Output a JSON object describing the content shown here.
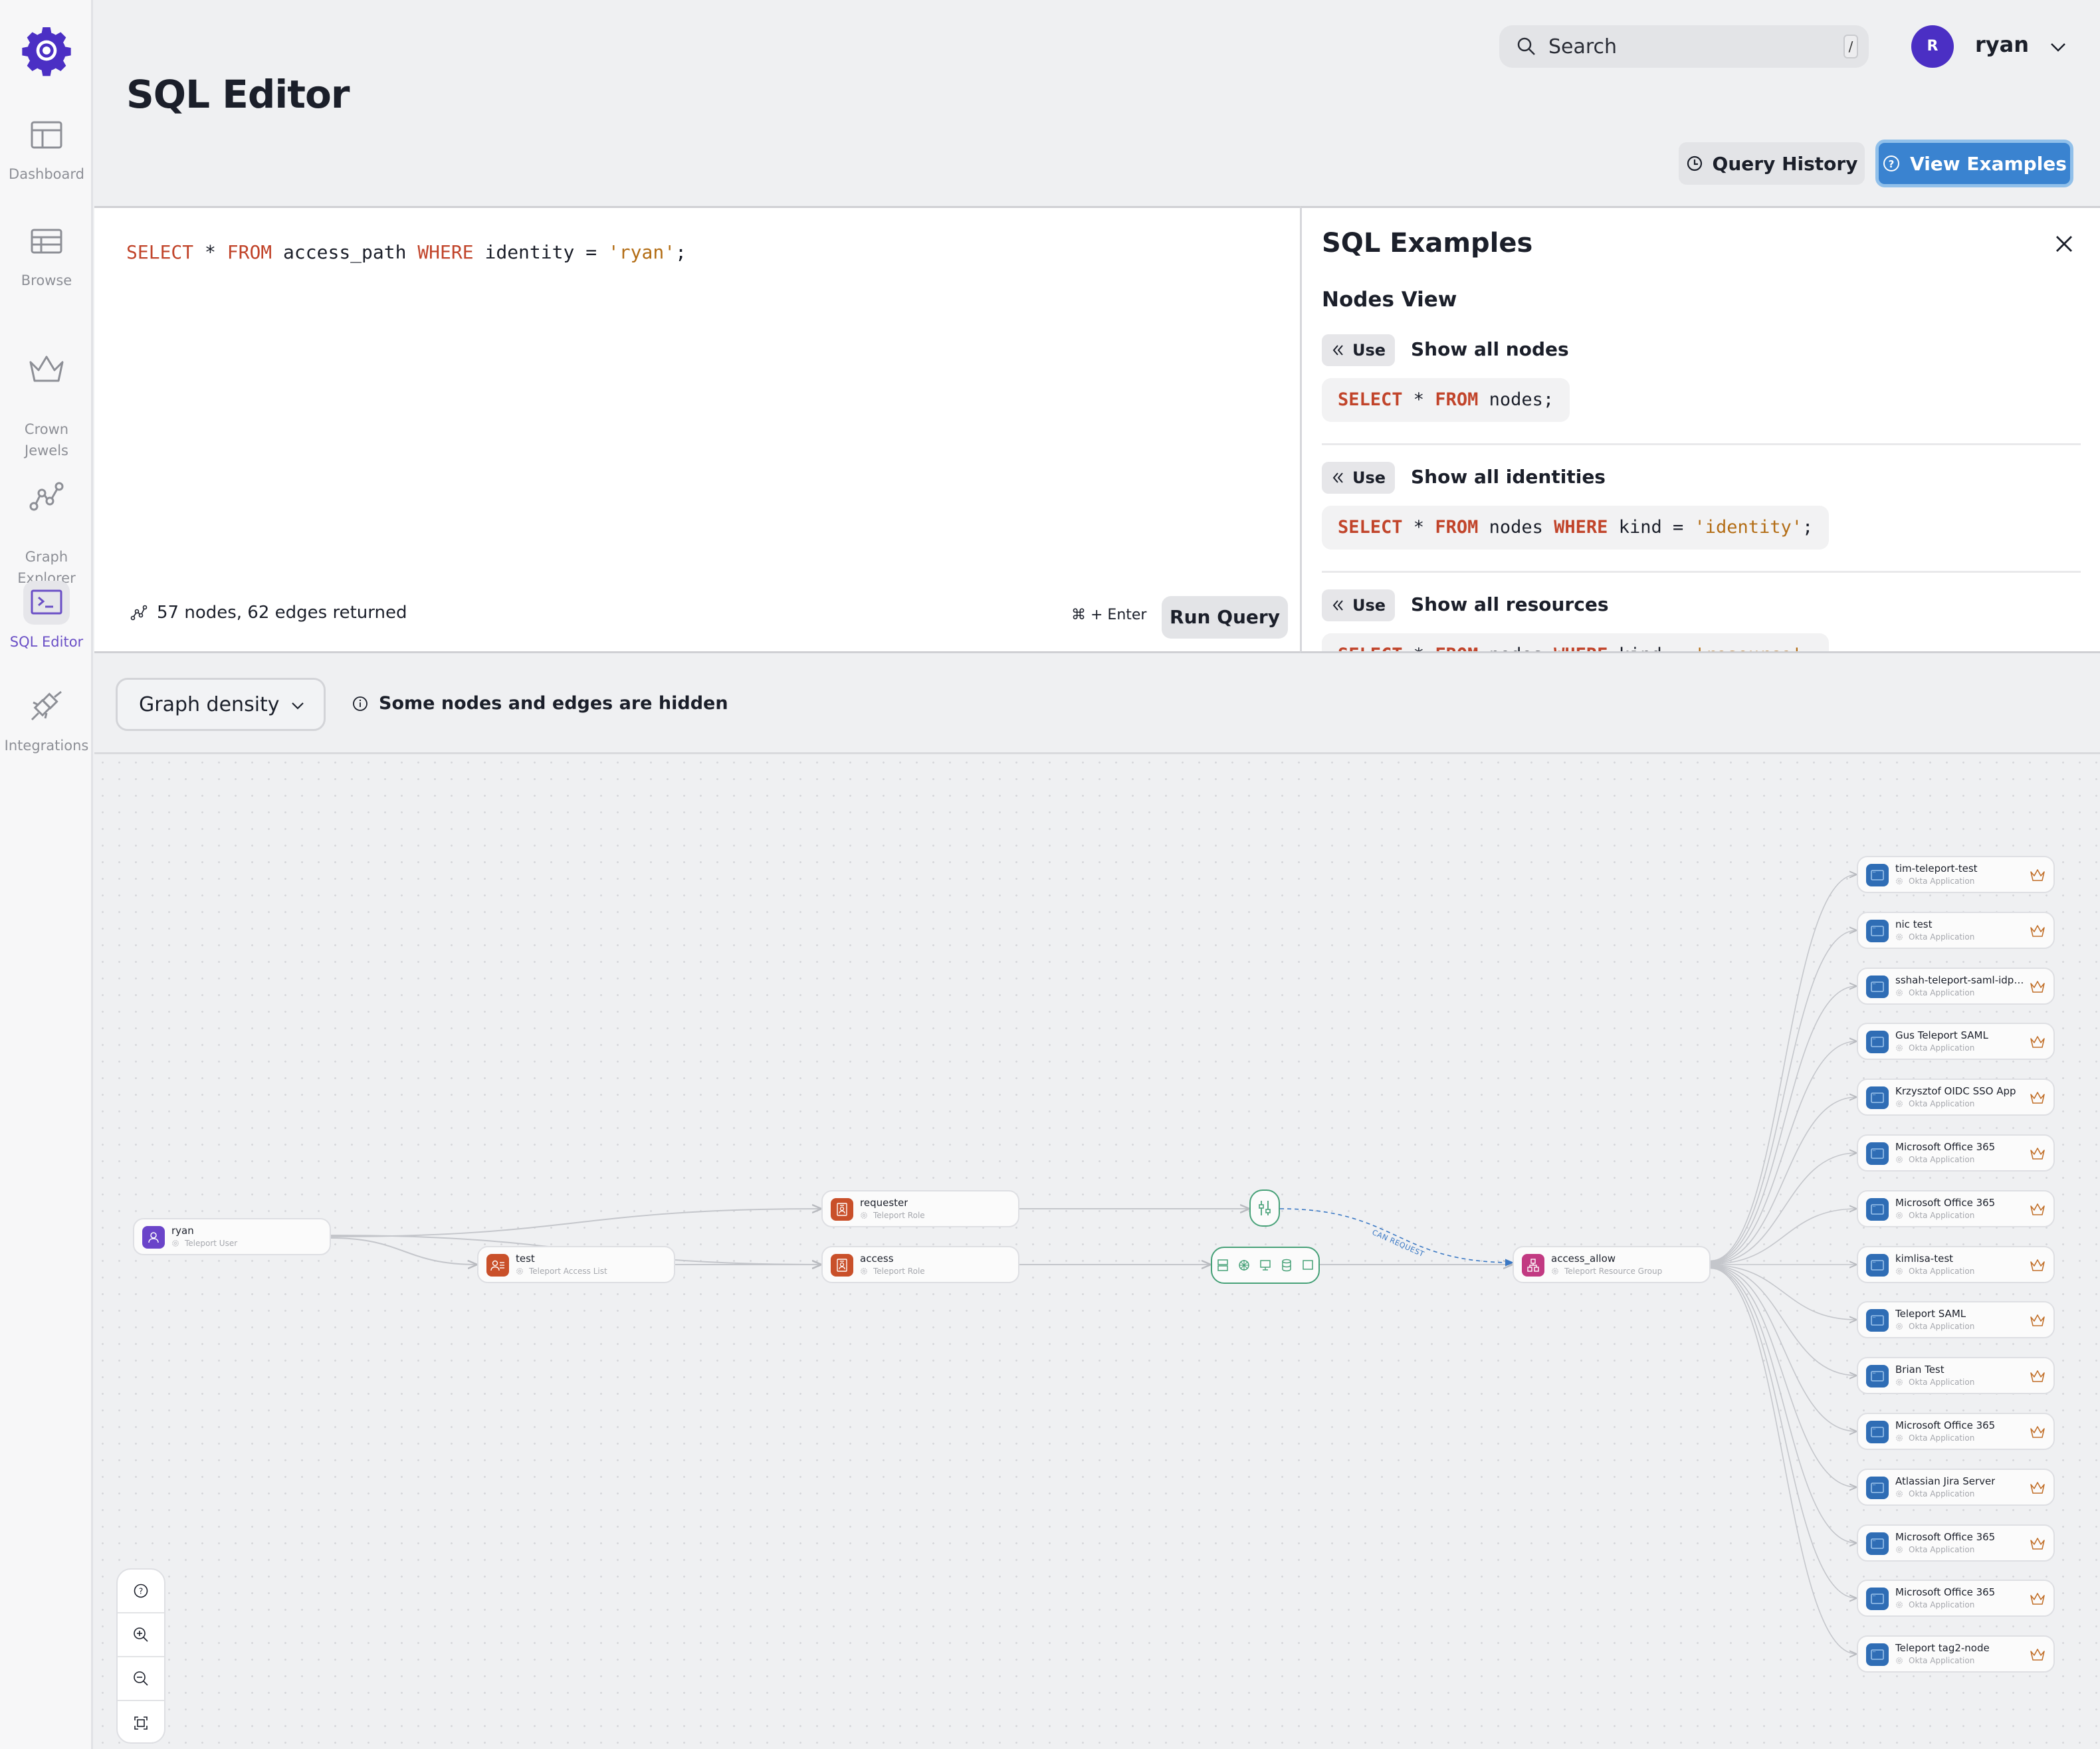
{
  "sidebar": {
    "logo": "gear-logo-icon",
    "items": [
      {
        "label": "Dashboard",
        "icon": "dashboard-icon",
        "active": false
      },
      {
        "label": "Browse",
        "icon": "table-icon",
        "active": false
      },
      {
        "label": "Crown\nJewels",
        "icon": "crown-icon",
        "active": false
      },
      {
        "label": "Graph\nExplorer",
        "icon": "graph-icon",
        "active": false
      },
      {
        "label": "SQL Editor",
        "icon": "terminal-icon",
        "active": true
      },
      {
        "label": "Integrations",
        "icon": "plug-icon",
        "active": false
      }
    ]
  },
  "header": {
    "title": "SQL Editor",
    "search": {
      "placeholder": "Search",
      "shortcut": "/"
    },
    "user": {
      "initial": "R",
      "name": "ryan"
    },
    "query_history_label": "Query History",
    "view_examples_label": "View Examples"
  },
  "editor": {
    "query_tokens": [
      {
        "t": "SELECT",
        "c": "kw"
      },
      {
        "t": " * ",
        "c": ""
      },
      {
        "t": "FROM",
        "c": "kw"
      },
      {
        "t": " access_path ",
        "c": ""
      },
      {
        "t": "WHERE",
        "c": "kw"
      },
      {
        "t": " identity = ",
        "c": ""
      },
      {
        "t": "'ryan'",
        "c": "str"
      },
      {
        "t": ";",
        "c": ""
      }
    ],
    "result_summary": "57 nodes, 62 edges returned",
    "shortcut": "⌘ + Enter",
    "run_label": "Run Query"
  },
  "examples": {
    "title": "SQL Examples",
    "section": "Nodes View",
    "use_label": "Use",
    "items": [
      {
        "label": "Show all nodes",
        "query_tokens": [
          {
            "t": "SELECT",
            "c": "kw-b"
          },
          {
            "t": " * ",
            "c": ""
          },
          {
            "t": "FROM",
            "c": "kw-b"
          },
          {
            "t": " nodes;",
            "c": ""
          }
        ]
      },
      {
        "label": "Show all identities",
        "query_tokens": [
          {
            "t": "SELECT",
            "c": "kw-b"
          },
          {
            "t": " * ",
            "c": ""
          },
          {
            "t": "FROM",
            "c": "kw-b"
          },
          {
            "t": " nodes ",
            "c": ""
          },
          {
            "t": "WHERE",
            "c": "kw-b"
          },
          {
            "t": " kind = ",
            "c": ""
          },
          {
            "t": "'identity'",
            "c": "str"
          },
          {
            "t": ";",
            "c": ""
          }
        ]
      },
      {
        "label": "Show all resources",
        "query_tokens": [
          {
            "t": "SELECT",
            "c": "kw-b"
          },
          {
            "t": " * ",
            "c": ""
          },
          {
            "t": "FROM",
            "c": "kw-b"
          },
          {
            "t": " nodes ",
            "c": ""
          },
          {
            "t": "WHERE",
            "c": "kw-b"
          },
          {
            "t": " kind = ",
            "c": ""
          },
          {
            "t": "'resource'",
            "c": "str"
          },
          {
            "t": ";",
            "c": ""
          }
        ]
      }
    ]
  },
  "graph_toolbar": {
    "density_label": "Graph density",
    "hidden_notice": "Some nodes and edges are hidden"
  },
  "graph": {
    "nodes": [
      {
        "id": "ryan",
        "title": "ryan",
        "subtitle": "Teleport User",
        "kind": "user",
        "color": "#6a44c9"
      },
      {
        "id": "test",
        "title": "test",
        "subtitle": "Teleport Access List",
        "kind": "access-list",
        "color": "#c9502a"
      },
      {
        "id": "requester",
        "title": "requester",
        "subtitle": "Teleport Role",
        "kind": "role",
        "color": "#c9502a"
      },
      {
        "id": "access",
        "title": "access",
        "subtitle": "Teleport Role",
        "kind": "role",
        "color": "#c9502a"
      },
      {
        "id": "access_allow",
        "title": "access_allow",
        "subtitle": "Teleport Resource Group",
        "kind": "resource-group",
        "color": "#c23a82"
      }
    ],
    "apps": [
      "tim-teleport-test",
      "nic test",
      "sshah-teleport-saml-idp-app",
      "Gus Teleport SAML",
      "Krzysztof OIDC SSO App",
      "Microsoft Office 365",
      "Microsoft Office 365",
      "kimlisa-test",
      "Teleport SAML",
      "Brian Test",
      "Microsoft Office 365",
      "Atlassian Jira Server",
      "Microsoft Office 365",
      "Microsoft Office 365",
      "Teleport tag2-node"
    ],
    "app_subtitle": "Okta Application",
    "app_color": "#2f6db5",
    "crown_color": "#c2702a",
    "edge_label": "CAN REQUEST",
    "hub_color": "#47a178",
    "request_edge_color": "#3a78c4"
  },
  "zoom_controls": [
    {
      "name": "help-button",
      "icon": "help-icon"
    },
    {
      "name": "zoom-in-button",
      "icon": "zoom-in-icon"
    },
    {
      "name": "zoom-out-button",
      "icon": "zoom-out-icon"
    },
    {
      "name": "fit-view-button",
      "icon": "fit-view-icon"
    }
  ]
}
